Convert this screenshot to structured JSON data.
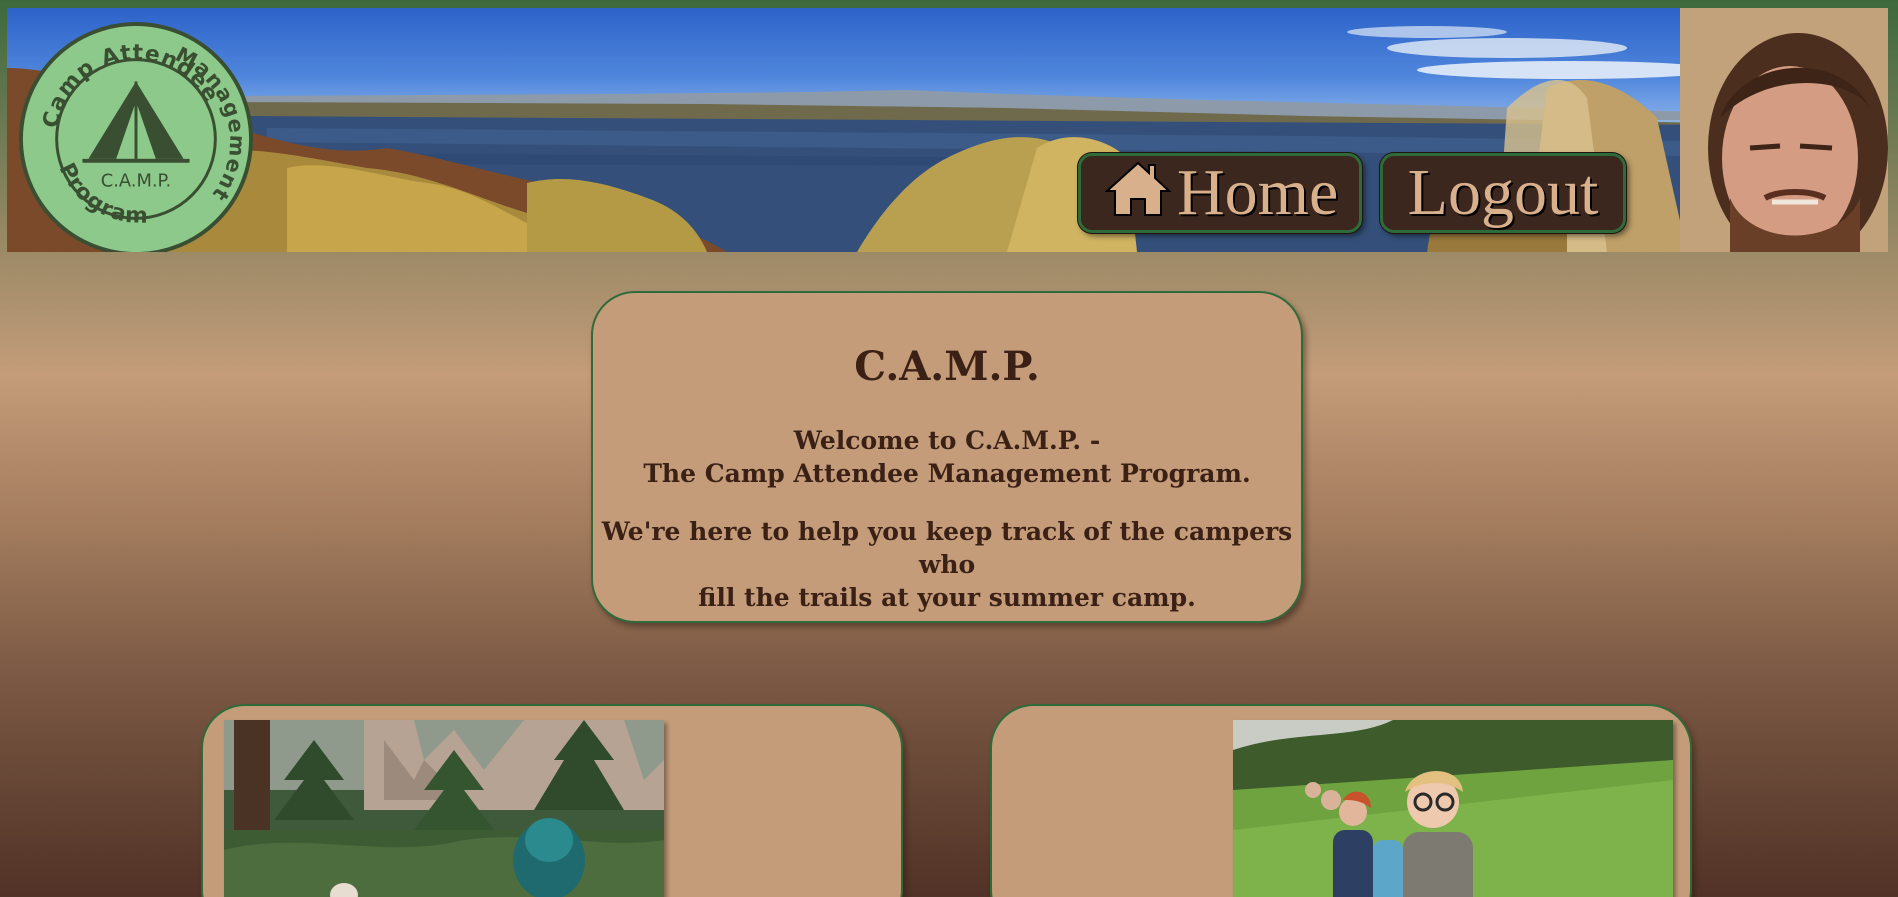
{
  "header": {
    "logo": {
      "ring_text_top": "Camp Attendee",
      "ring_text_right": "Management",
      "ring_text_bottom": "Program",
      "center_text": "C.A.M.P.",
      "fill_color": "#8cc98a",
      "ink_color": "#3a4f32"
    },
    "nav": {
      "home_label": "Home",
      "logout_label": "Logout"
    },
    "colors": {
      "top_bar": "#3f6a3e",
      "button_bg": "#3b271d",
      "button_text": "#d9b08c"
    }
  },
  "welcome": {
    "title": "C.A.M.P.",
    "subtitle_line1": "Welcome to C.A.M.P. -",
    "subtitle_line2": "The Camp Attendee Management Program.",
    "body_line1": "We're here to help you keep track of the campers who",
    "body_line2": "fill the trails at your summer camp."
  },
  "colors": {
    "card_bg": "#c49c79",
    "card_border": "#2f6b3a",
    "text": "#3b2016"
  }
}
